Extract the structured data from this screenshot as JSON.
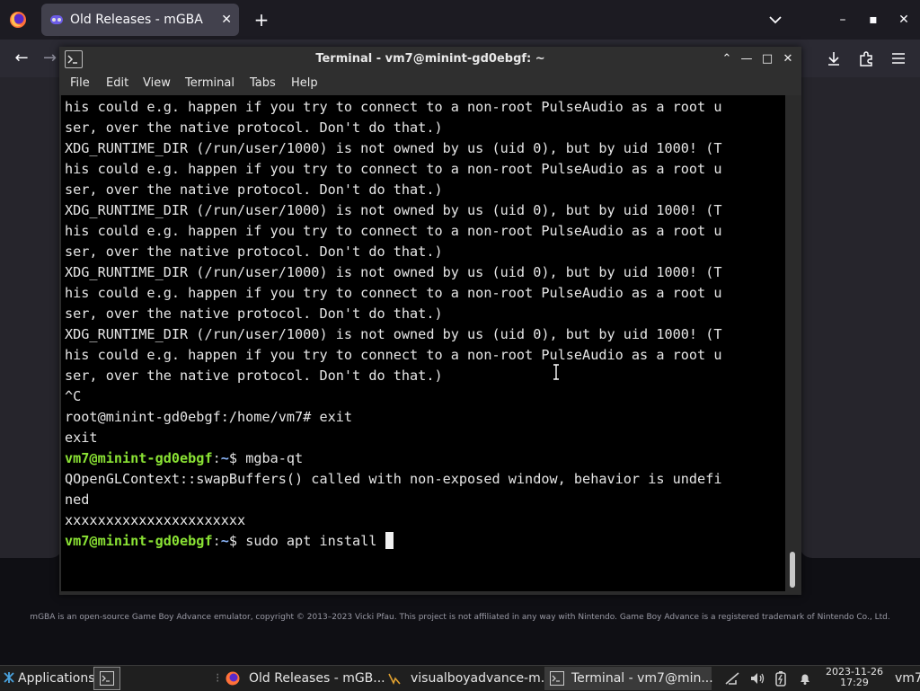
{
  "firefox": {
    "tab_title": "Old Releases - mGBA",
    "tab_close": "✕",
    "new_tab": "+",
    "back": "←",
    "forward": "→",
    "footer": "mGBA is an open-source Game Boy Advance emulator, copyright © 2013–2023 Vicki Pfau. This project is not affiliated in any way with Nintendo. Game Boy Advance is a registered trademark of Nintendo Co., Ltd.",
    "win_minimize": "–",
    "win_maximize": "▪",
    "win_close": "✕"
  },
  "terminal": {
    "title": "Terminal - vm7@minint-gd0ebgf: ~",
    "menu": [
      "File",
      "Edit",
      "View",
      "Terminal",
      "Tabs",
      "Help"
    ],
    "btn_up": "⌃",
    "btn_min": "—",
    "btn_max": "□",
    "btn_close": "✕",
    "lines": [
      "his could e.g. happen if you try to connect to a non-root PulseAudio as a root u",
      "ser, over the native protocol. Don't do that.)",
      "XDG_RUNTIME_DIR (/run/user/1000) is not owned by us (uid 0), but by uid 1000! (T",
      "his could e.g. happen if you try to connect to a non-root PulseAudio as a root u",
      "ser, over the native protocol. Don't do that.)",
      "XDG_RUNTIME_DIR (/run/user/1000) is not owned by us (uid 0), but by uid 1000! (T",
      "his could e.g. happen if you try to connect to a non-root PulseAudio as a root u",
      "ser, over the native protocol. Don't do that.)",
      "XDG_RUNTIME_DIR (/run/user/1000) is not owned by us (uid 0), but by uid 1000! (T",
      "his could e.g. happen if you try to connect to a non-root PulseAudio as a root u",
      "ser, over the native protocol. Don't do that.)",
      "XDG_RUNTIME_DIR (/run/user/1000) is not owned by us (uid 0), but by uid 1000! (T",
      "his could e.g. happen if you try to connect to a non-root PulseAudio as a root u",
      "ser, over the native protocol. Don't do that.)",
      "^C",
      "root@minint-gd0ebgf:/home/vm7# exit",
      "exit"
    ],
    "prompt1": {
      "user": "vm7@minint-gd0ebgf",
      "sep": ":",
      "path": "~",
      "cmd": "$ mgba-qt"
    },
    "lines2": [
      "QOpenGLContext::swapBuffers() called with non-exposed window, behavior is undefi",
      "ned",
      "xxxxxxxxxxxxxxxxxxxxxx"
    ],
    "prompt2": {
      "user": "vm7@minint-gd0ebgf",
      "sep": ":",
      "path": "~",
      "cmd": "$ sudo apt install "
    }
  },
  "taskbar": {
    "applications": "Applications",
    "tasks": [
      "Old Releases - mGB...",
      "visualboyadvance-m...",
      "Terminal - vm7@min..."
    ],
    "date": "2023-11-26",
    "time": "17:29",
    "user": "vm7"
  },
  "colors": {
    "prompt_user": "#8ae234",
    "prompt_path": "#8ab4f8",
    "firefox_bg": "#1c1b22",
    "terminal_bg": "#000000"
  }
}
